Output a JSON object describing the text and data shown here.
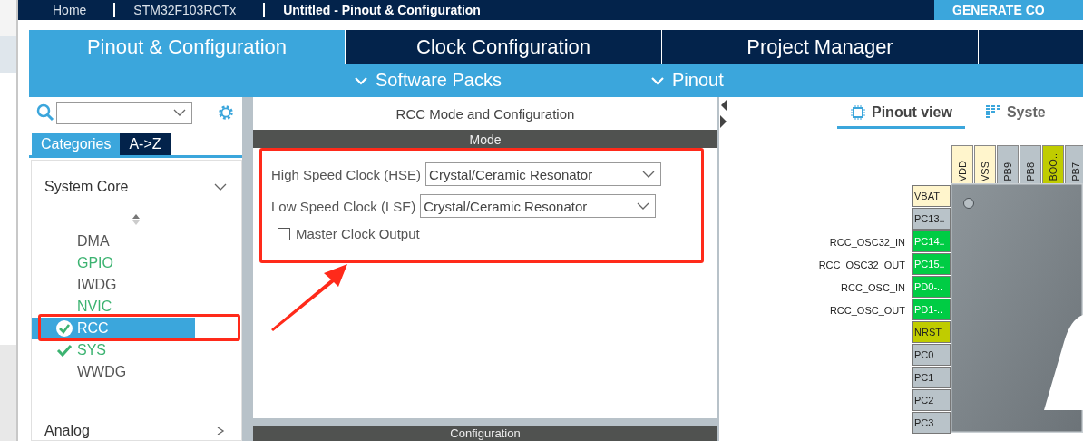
{
  "breadcrumb": {
    "items": [
      {
        "label": "Home",
        "current": false
      },
      {
        "label": "STM32F103RCTx",
        "current": false
      },
      {
        "label": "Untitled - Pinout & Configuration",
        "current": true
      }
    ],
    "generate_button": "GENERATE CO"
  },
  "tabs": [
    {
      "label": "Pinout & Configuration",
      "selected": true
    },
    {
      "label": "Clock Configuration",
      "selected": false
    },
    {
      "label": "Project Manager",
      "selected": false
    },
    {
      "selected": false
    }
  ],
  "subbar": [
    "Software Packs",
    "Pinout"
  ],
  "sidebar": {
    "tabs": [
      {
        "label": "Categories",
        "selected": true
      },
      {
        "label": "A->Z",
        "selected": false
      }
    ],
    "group": {
      "label": "System Core",
      "expanded": true
    },
    "items": [
      {
        "label": "DMA",
        "selected": false,
        "configured": false,
        "color": "#555555"
      },
      {
        "label": "GPIO",
        "selected": false,
        "configured": false,
        "color": "#3cb371"
      },
      {
        "label": "IWDG",
        "selected": false,
        "configured": false,
        "color": "#555555"
      },
      {
        "label": "NVIC",
        "selected": false,
        "configured": false,
        "color": "#3cb371"
      },
      {
        "label": "RCC",
        "selected": true,
        "configured": true,
        "color": "#ffffff"
      },
      {
        "label": "SYS",
        "selected": false,
        "configured": true,
        "color": "#3cb371"
      },
      {
        "label": "WWDG",
        "selected": false,
        "configured": false,
        "color": "#555555"
      }
    ],
    "next_group": {
      "label": "Analog",
      "expanded": false
    }
  },
  "mode_panel": {
    "title": "RCC Mode and Configuration",
    "section": "Mode",
    "fields": [
      {
        "label": "High Speed Clock (HSE)",
        "value": "Crystal/Ceramic Resonator"
      },
      {
        "label": "Low Speed Clock (LSE)",
        "value": "Crystal/Ceramic Resonator"
      }
    ],
    "checkbox": {
      "label": "Master Clock Output",
      "checked": false
    },
    "config_section": "Configuration"
  },
  "pinout": {
    "tabs": [
      {
        "label": "Pinout view",
        "selected": true
      },
      {
        "label": "Syste",
        "selected": false
      }
    ],
    "top_pins": [
      {
        "label": "VDD",
        "color": "#fff5cc"
      },
      {
        "label": "VSS",
        "color": "#fff5cc"
      },
      {
        "label": "PB9",
        "color": "#b9c3c9"
      },
      {
        "label": "PB8",
        "color": "#b9c3c9"
      },
      {
        "label": "BOO..",
        "color": "#c0cc00"
      },
      {
        "label": "PB7",
        "color": "#b9c3c9"
      }
    ],
    "left_pins": [
      {
        "label": "VBAT",
        "color": "#fff5cc"
      },
      {
        "label": "PC13..",
        "color": "#b9c3c9"
      },
      {
        "label": "PC14..",
        "signal": "RCC_OSC32_IN",
        "color": "#00cc44"
      },
      {
        "label": "PC15..",
        "signal": "RCC_OSC32_OUT",
        "color": "#00cc44"
      },
      {
        "label": "PD0-..",
        "signal": "RCC_OSC_IN",
        "color": "#00cc44"
      },
      {
        "label": "PD1-..",
        "signal": "RCC_OSC_OUT",
        "color": "#00cc44"
      },
      {
        "label": "NRST",
        "color": "#c0cc00"
      },
      {
        "label": "PC0",
        "color": "#b9c3c9"
      },
      {
        "label": "PC1",
        "color": "#b9c3c9"
      },
      {
        "label": "PC2",
        "color": "#b9c3c9"
      },
      {
        "label": "PC3",
        "color": "#b9c3c9"
      }
    ]
  }
}
